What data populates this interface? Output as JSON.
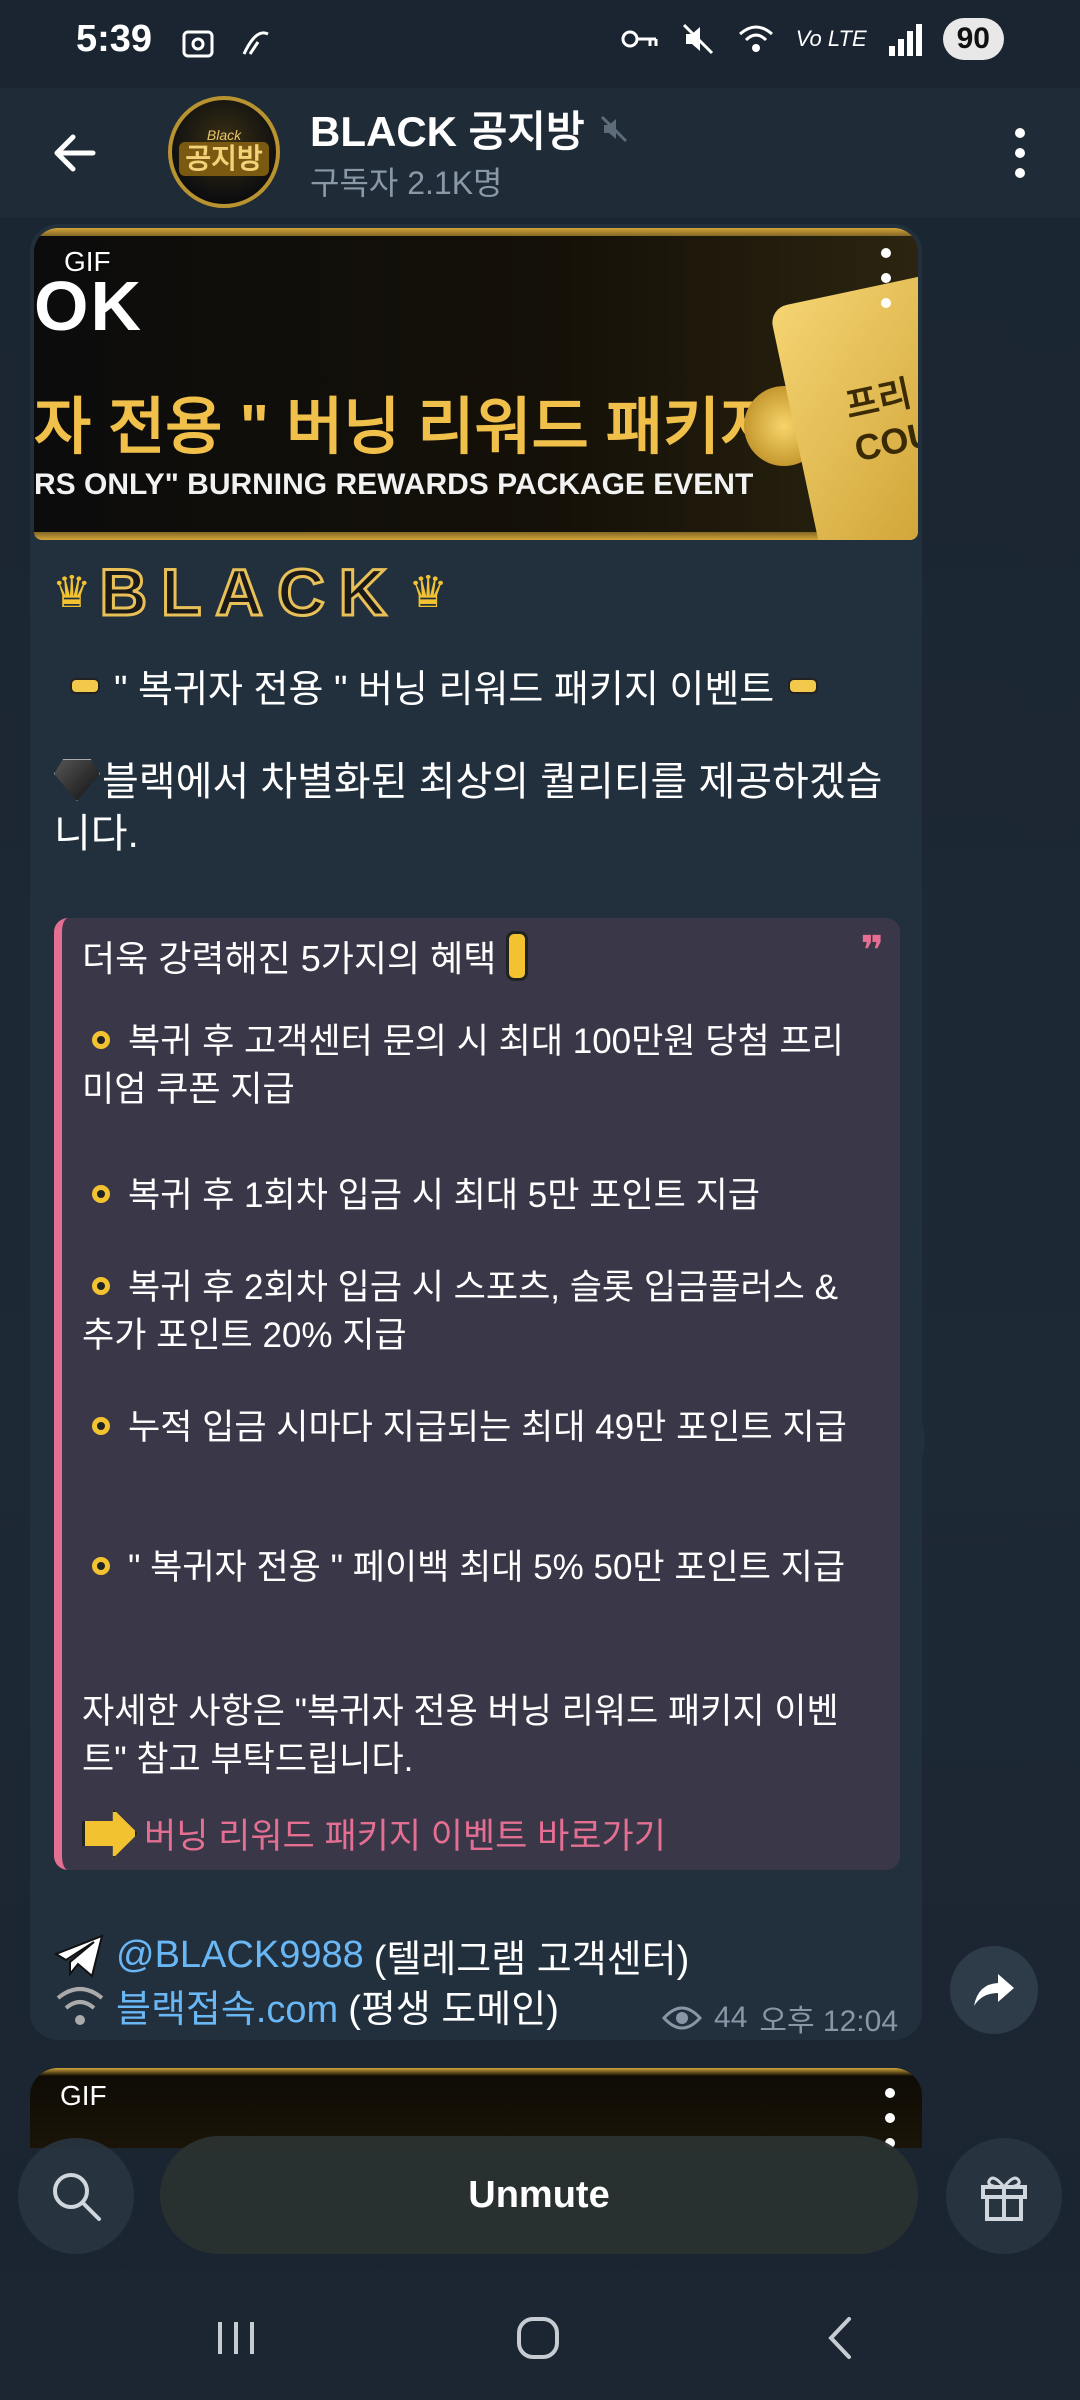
{
  "status_bar": {
    "time": "5:39",
    "battery": "90",
    "network": "Vo LTE"
  },
  "header": {
    "title": "BLACK 공지방",
    "subtitle": "구독자 2.1K명",
    "avatar_top": "Black",
    "avatar_text": "공지방"
  },
  "message": {
    "media_label": "GIF",
    "banner": {
      "brand_fragment": "OK",
      "title_kr": "자 전용 \" 버닝 리워드 패키지 이벤트",
      "title_en": "RS ONLY\" BURNING REWARDS PACKAGE EVENT",
      "coupon_text": "프리\nCOU"
    },
    "black_title": "BLACK",
    "event_line": "\" 복귀자 전용 \" 버닝 리워드 패키지 이벤트",
    "intro": "블랙에서 차별화된 최상의 퀄리티를 제공하겠습니다.",
    "quote": {
      "heading": "더욱 강력해진 5가지의 혜택",
      "benefits": [
        "복귀 후 고객센터 문의 시 최대 100만원 당첨 프리미엄 쿠폰 지급",
        "복귀 후 1회차 입금 시 최대 5만 포인트 지급",
        "복귀 후 2회차 입금 시 스포츠, 슬롯 입금플러스 & 추가 포인트 20% 지급",
        "누적 입금 시마다 지급되는 최대 49만 포인트 지급",
        "\" 복귀자 전용 \" 페이백 최대 5% 50만 포인트 지급"
      ],
      "detail": "자세한 사항은 \"복귀자 전용 버닝 리워드 패키지 이벤트\" 참고 부탁드립니다.",
      "shortcut": "버닝 리워드 패키지 이벤트 바로가기"
    },
    "contacts": [
      {
        "link": "@BLACK9988",
        "note": "(텔레그램 고객센터)"
      },
      {
        "link": "블랙접속.com",
        "note": "(평생 도메인)"
      }
    ],
    "views": "44",
    "time": "오후 12:04"
  },
  "next_message": {
    "media_label": "GIF"
  },
  "controls": {
    "unmute_label": "Unmute"
  },
  "colors": {
    "accent_pink": "#e56e93",
    "link_blue": "#6ab7f5",
    "gold": "#f2c230"
  }
}
